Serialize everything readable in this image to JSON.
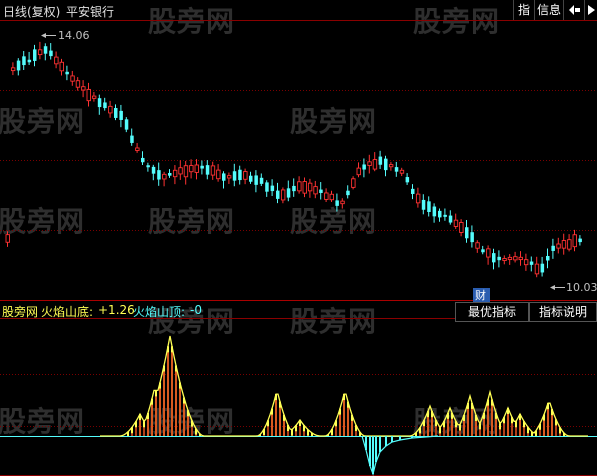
{
  "header": {
    "period_label": "日线(复权)",
    "stock_name": "平安银行"
  },
  "toolbar": {
    "zhi_label": "指",
    "info_label": "信息",
    "arrow_icon": "arrow-icon"
  },
  "watermark": "股旁网",
  "price_chart": {
    "high_label": "14.06",
    "low_label": "10.03",
    "cai_label": "财",
    "colors": {
      "up": "#ff3232",
      "down": "#54fcfc",
      "grid": "#7a0000",
      "label": "#c0c0c0"
    }
  },
  "indicator": {
    "source_label": "股旁网",
    "bottom_name": "火焰山底:",
    "bottom_value": "+1.26",
    "top_name": "火焰山顶:",
    "top_value": "-0",
    "best_button": "最优指标",
    "explain_button": "指标说明",
    "colors": {
      "bottom": "#ffff54",
      "top": "#54fcfc"
    }
  }
}
